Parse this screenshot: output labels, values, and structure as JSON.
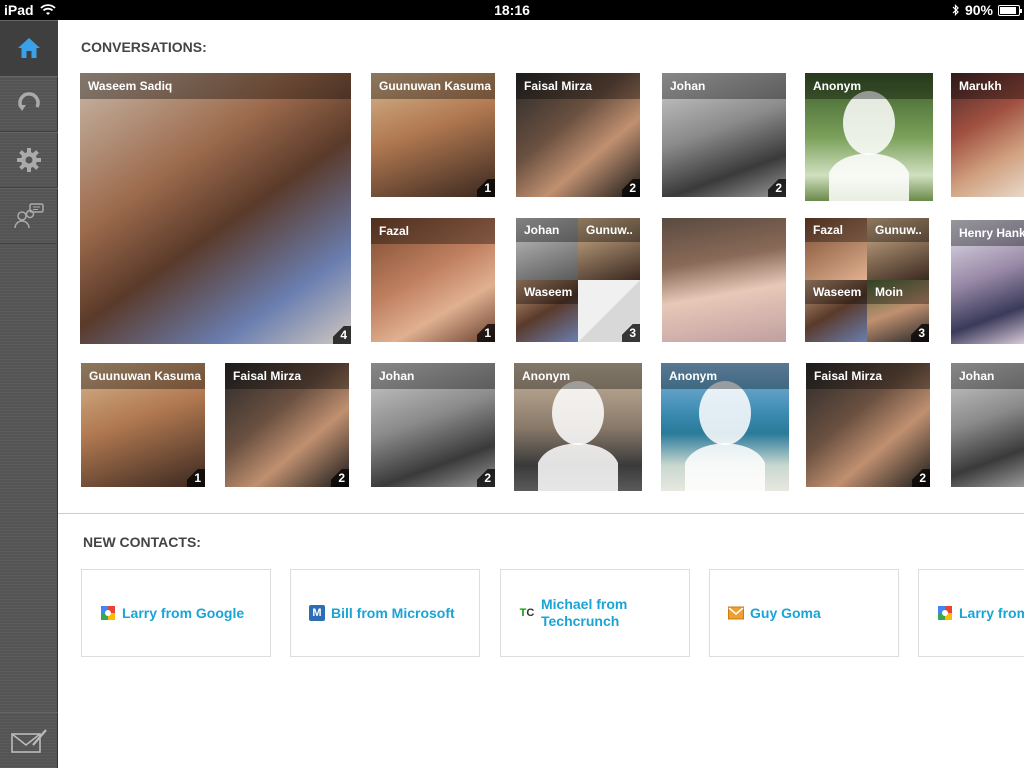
{
  "status": {
    "device": "iPad",
    "time": "18:16",
    "battery": "90%",
    "battery_level": 0.9
  },
  "sidebar": {
    "items": [
      {
        "name": "home-icon",
        "active": true
      },
      {
        "name": "refresh-icon",
        "active": false
      },
      {
        "name": "gear-icon",
        "active": false
      },
      {
        "name": "contacts-chat-icon",
        "active": false
      }
    ],
    "compose": "compose-mail-icon"
  },
  "conversations": {
    "title": "CONVERSATIONS:",
    "tiles": [
      {
        "name": "Waseem Sadiq",
        "count": "4"
      },
      {
        "name": "Guunuwan Kasuma",
        "count": "1"
      },
      {
        "name": "Faisal Mirza",
        "count": "2"
      },
      {
        "name": "Johan",
        "count": "2"
      },
      {
        "name": "Anonym",
        "count": ""
      },
      {
        "name": "Marukh",
        "count": ""
      },
      {
        "name": "Fazal",
        "count": "1"
      },
      {
        "names": [
          "Johan",
          "Gunuw..",
          "Waseem"
        ],
        "count": "3"
      },
      {
        "name": "",
        "count": ""
      },
      {
        "names": [
          "Fazal",
          "Gunuw..",
          "Waseem",
          "Moin"
        ],
        "count": "3"
      },
      {
        "name": "Henry Hank",
        "count": ""
      },
      {
        "name": "Guunuwan Kasuma",
        "count": "1"
      },
      {
        "name": "Faisal Mirza",
        "count": "2"
      },
      {
        "name": "Johan",
        "count": "2"
      },
      {
        "name": "Anonym",
        "count": ""
      },
      {
        "name": "Anonym",
        "count": ""
      },
      {
        "name": "Faisal Mirza",
        "count": "2"
      },
      {
        "name": "Johan",
        "count": ""
      }
    ]
  },
  "new_contacts": {
    "title": "NEW CONTACTS:",
    "items": [
      {
        "label": "Larry from Google",
        "icon": "google-icon"
      },
      {
        "label": "Bill from Microsoft",
        "icon": "microsoft-icon"
      },
      {
        "label": "Michael from Techcrunch",
        "icon": "techcrunch-icon"
      },
      {
        "label": "Guy Goma",
        "icon": "email-icon"
      },
      {
        "label": "Larry from",
        "icon": "google-icon"
      }
    ]
  },
  "colors": {
    "accent": "#1aa4d6",
    "sidebar": "#545454",
    "statusbar": "#000000"
  }
}
